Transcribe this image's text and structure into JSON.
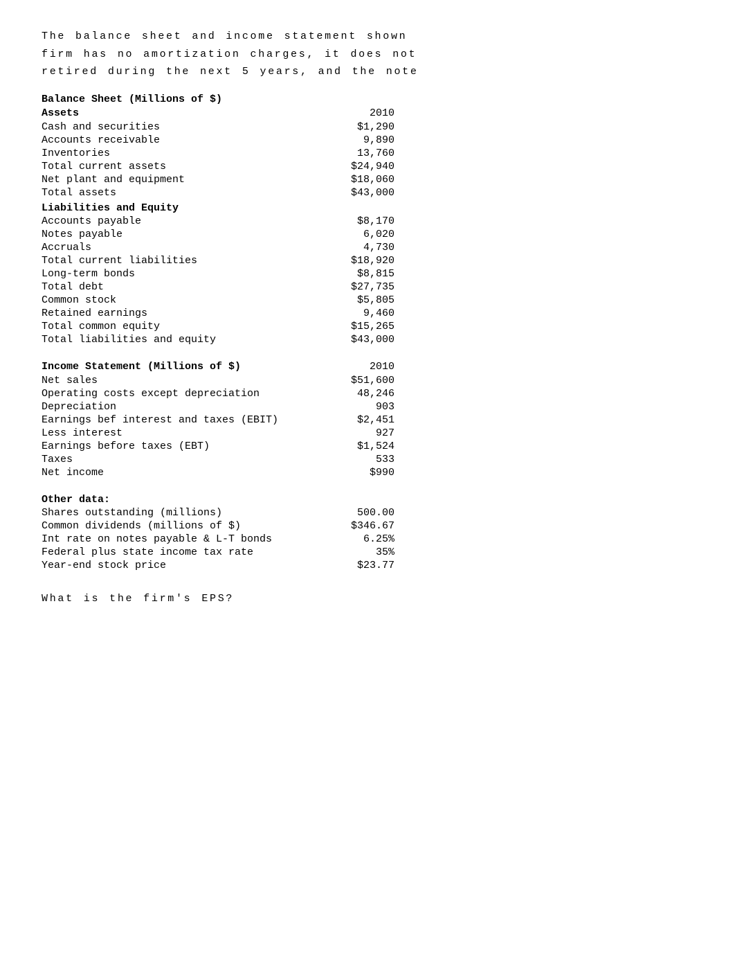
{
  "intro": {
    "line1": "The  balance  sheet  and  income  statement  shown",
    "line2": "firm  has  no  amortization  charges,  it  does  not",
    "line3": "retired  during  the  next  5  years,  and  the  note"
  },
  "balance_sheet": {
    "title": "Balance Sheet  (Millions of $)",
    "year": "2010",
    "assets_label": "Assets",
    "assets": [
      {
        "label": "Cash and securities",
        "value": "$1,290"
      },
      {
        "label": "Accounts receivable",
        "value": "9,890"
      },
      {
        "label": "Inventories",
        "value": "13,760"
      },
      {
        "label": "Total current assets",
        "value": "$24,940"
      },
      {
        "label": "Net plant and equipment",
        "value": "$18,060"
      },
      {
        "label": "Total assets",
        "value": "$43,000"
      }
    ],
    "liabilities_label": "Liabilities and Equity",
    "liabilities": [
      {
        "label": "Accounts payable",
        "value": "$8,170"
      },
      {
        "label": "Notes payable",
        "value": "6,020"
      },
      {
        "label": "Accruals",
        "value": "4,730"
      },
      {
        "label": "Total current liabilities",
        "value": "$18,920"
      },
      {
        "label": "Long-term bonds",
        "value": "$8,815"
      },
      {
        "label": "Total debt",
        "value": "$27,735"
      },
      {
        "label": "Common stock",
        "value": "$5,805"
      },
      {
        "label": "Retained earnings",
        "value": "9,460"
      },
      {
        "label": "Total common equity",
        "value": "$15,265"
      },
      {
        "label": "Total liabilities and equity",
        "value": "$43,000"
      }
    ]
  },
  "income_statement": {
    "title": "Income Statement (Millions of $)",
    "year": "2010",
    "items": [
      {
        "label": "Net sales",
        "value": "$51,600"
      },
      {
        "label": "Operating costs except depreciation",
        "value": "48,246"
      },
      {
        "label": "Depreciation",
        "value": "903"
      },
      {
        "label": "Earnings bef interest and taxes (EBIT)",
        "value": "$2,451"
      },
      {
        "label": "Less interest",
        "value": "927"
      },
      {
        "label": "Earnings before taxes (EBT)",
        "value": "$1,524"
      },
      {
        "label": "Taxes",
        "value": "533"
      },
      {
        "label": "Net income",
        "value": "$990"
      }
    ]
  },
  "other_data": {
    "title": "Other data:",
    "items": [
      {
        "label": "Shares outstanding (millions)",
        "value": "500.00"
      },
      {
        "label": "Common dividends (millions of $)",
        "value": "$346.67"
      },
      {
        "label": "Int rate on notes payable & L-T bonds",
        "value": "6.25%"
      },
      {
        "label": "Federal plus state income tax rate",
        "value": "35%"
      },
      {
        "label": "Year-end stock price",
        "value": "$23.77"
      }
    ]
  },
  "question": "What  is  the  firm's  EPS?"
}
